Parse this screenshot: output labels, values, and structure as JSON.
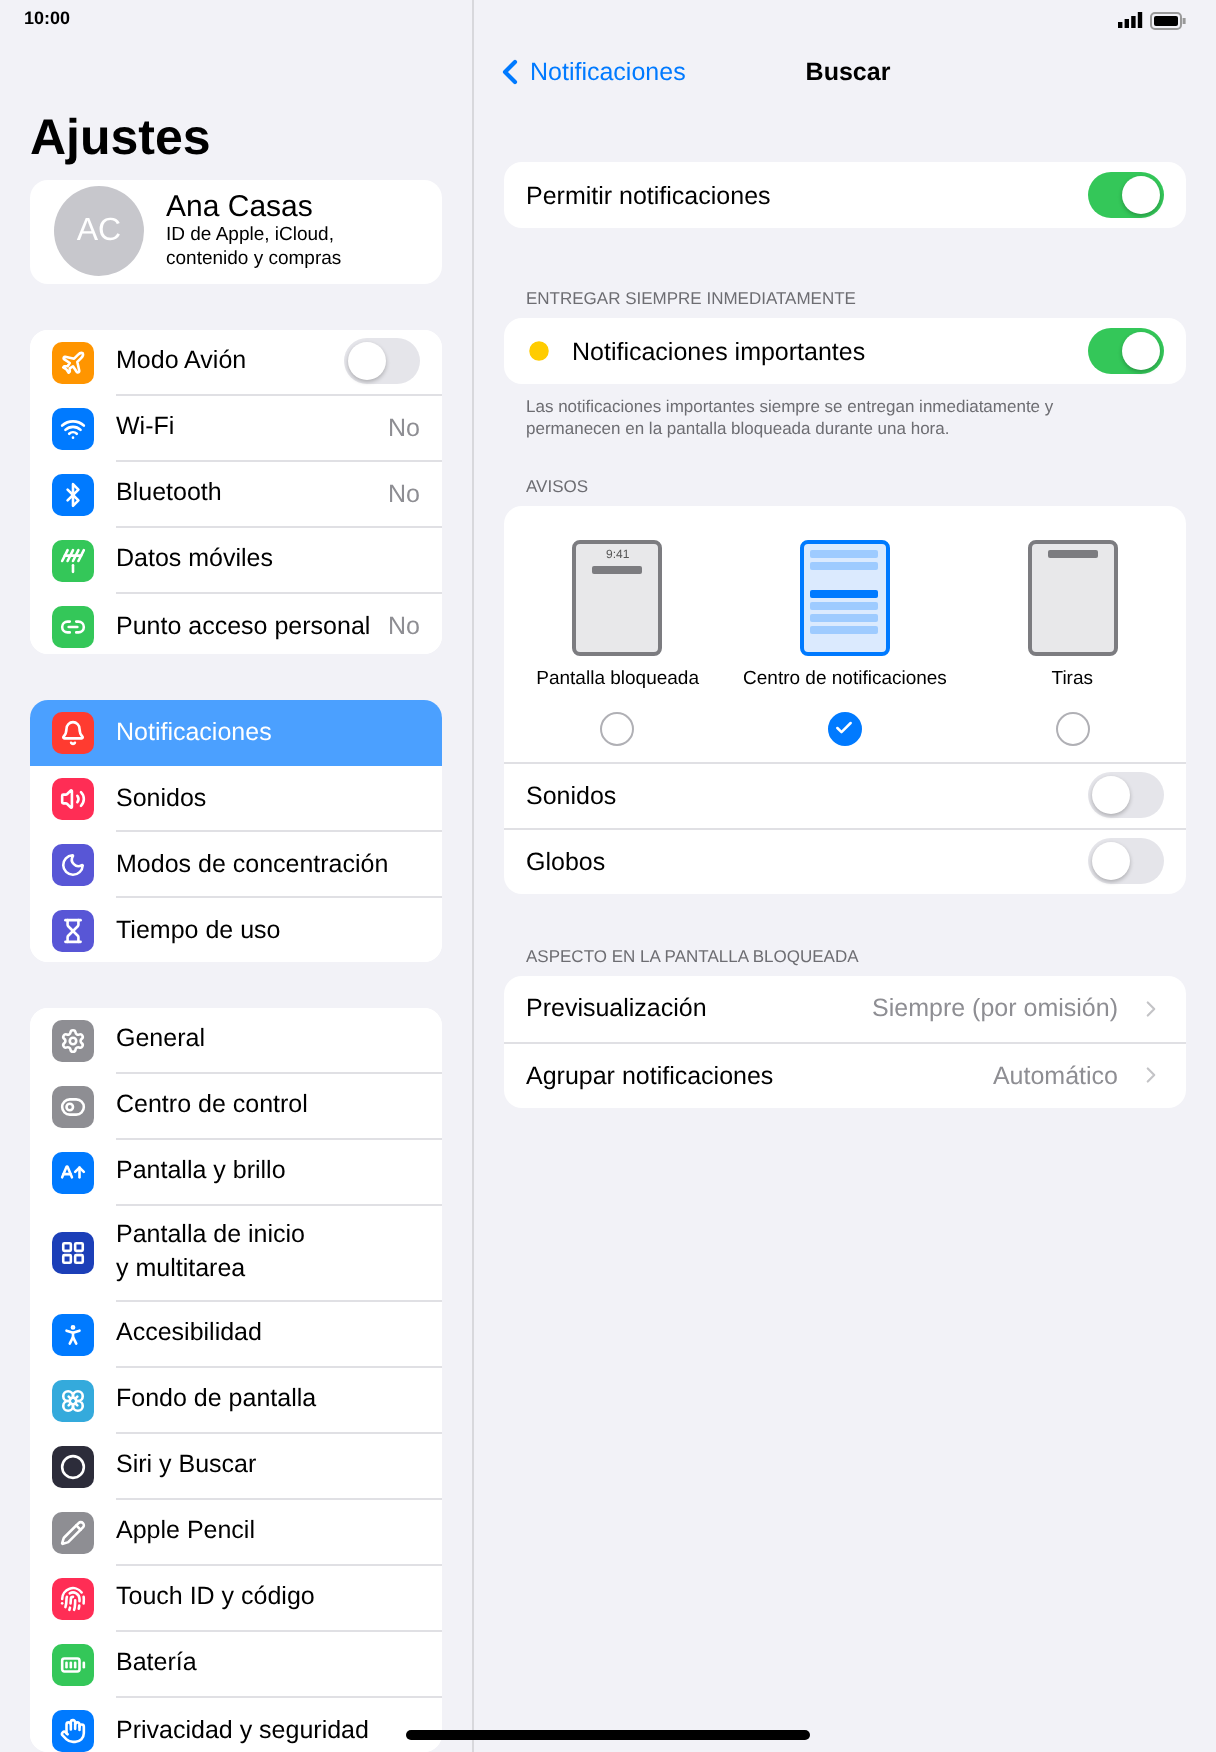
{
  "status_bar": {
    "time": "10:00"
  },
  "sidebar": {
    "title": "Ajustes",
    "profile": {
      "initials": "AC",
      "name": "Ana Casas",
      "subtitle": "ID de Apple, iCloud, contenido y compras"
    },
    "groups": [
      {
        "items": [
          {
            "label": "Modo Avión",
            "kind": "toggle",
            "on": false,
            "selected": false,
            "color": "#ff9500"
          },
          {
            "label": "Wi-Fi",
            "kind": "value",
            "value": "No",
            "selected": false,
            "color": "#007aff"
          },
          {
            "label": "Bluetooth",
            "kind": "value",
            "value": "No",
            "selected": false,
            "color": "#007aff"
          },
          {
            "label": "Datos móviles",
            "kind": "link",
            "selected": false,
            "color": "#34c759"
          },
          {
            "label": "Punto acceso personal",
            "kind": "value",
            "value": "No",
            "selected": false,
            "color": "#34c759"
          }
        ]
      },
      {
        "items": [
          {
            "label": "Notificaciones",
            "kind": "link",
            "selected": true,
            "color": "#ff3b30"
          },
          {
            "label": "Sonidos",
            "kind": "link",
            "selected": false,
            "color": "#ff2d55"
          },
          {
            "label": "Modos de concentración",
            "kind": "link",
            "selected": false,
            "color": "#5856d6"
          },
          {
            "label": "Tiempo de uso",
            "kind": "link",
            "selected": false,
            "color": "#5856d6"
          }
        ]
      },
      {
        "items": [
          {
            "label": "General",
            "kind": "link",
            "selected": false,
            "color": "#8e8e93"
          },
          {
            "label": "Centro de control",
            "kind": "link",
            "selected": false,
            "color": "#8e8e93"
          },
          {
            "label": "Pantalla y brillo",
            "kind": "link",
            "selected": false,
            "color": "#007aff"
          },
          {
            "label": "Pantalla de inicio\ny multitarea",
            "kind": "link",
            "selected": false,
            "color": "#1c3fb8"
          },
          {
            "label": "Accesibilidad",
            "kind": "link",
            "selected": false,
            "color": "#007aff"
          },
          {
            "label": "Fondo de pantalla",
            "kind": "link",
            "selected": false,
            "color": "#34aadc"
          },
          {
            "label": "Siri y Buscar",
            "kind": "link",
            "selected": false,
            "color": "#2c2c3a"
          },
          {
            "label": "Apple Pencil",
            "kind": "link",
            "selected": false,
            "color": "#8e8e93"
          },
          {
            "label": "Touch ID y código",
            "kind": "link",
            "selected": false,
            "color": "#ff2d55"
          },
          {
            "label": "Batería",
            "kind": "link",
            "selected": false,
            "color": "#34c759"
          },
          {
            "label": "Privacidad y seguridad",
            "kind": "link",
            "selected": false,
            "color": "#007aff"
          }
        ]
      }
    ]
  },
  "detail": {
    "back": "Notificaciones",
    "title": "Buscar",
    "allow": {
      "label": "Permitir notificaciones",
      "on": true
    },
    "immediate_header": "ENTREGAR SIEMPRE INMEDIATAMENTE",
    "important": {
      "label": "Notificaciones importantes",
      "on": true
    },
    "footnote": "Las notificaciones importantes siempre se entregan inmediatamente y permanecen en la pantalla bloqueada durante una hora.",
    "alerts_header": "AVISOS",
    "alert_styles": [
      {
        "kind": "lock",
        "label": "Pantalla bloqueada",
        "preview_time": "9:41",
        "selected": false
      },
      {
        "kind": "center",
        "label": "Centro de notificaciones",
        "selected": true
      },
      {
        "kind": "banner",
        "label": "Tiras",
        "selected": false
      }
    ],
    "alert_toggles": [
      {
        "label": "Sonidos",
        "on": false
      },
      {
        "label": "Globos",
        "on": false
      }
    ],
    "lock_header": "ASPECTO EN LA PANTALLA BLOQUEADA",
    "lock_rows": [
      {
        "label": "Previsualización",
        "value": "Siempre (por omisión)"
      },
      {
        "label": "Agrupar notificaciones",
        "value": "Automático"
      }
    ]
  }
}
